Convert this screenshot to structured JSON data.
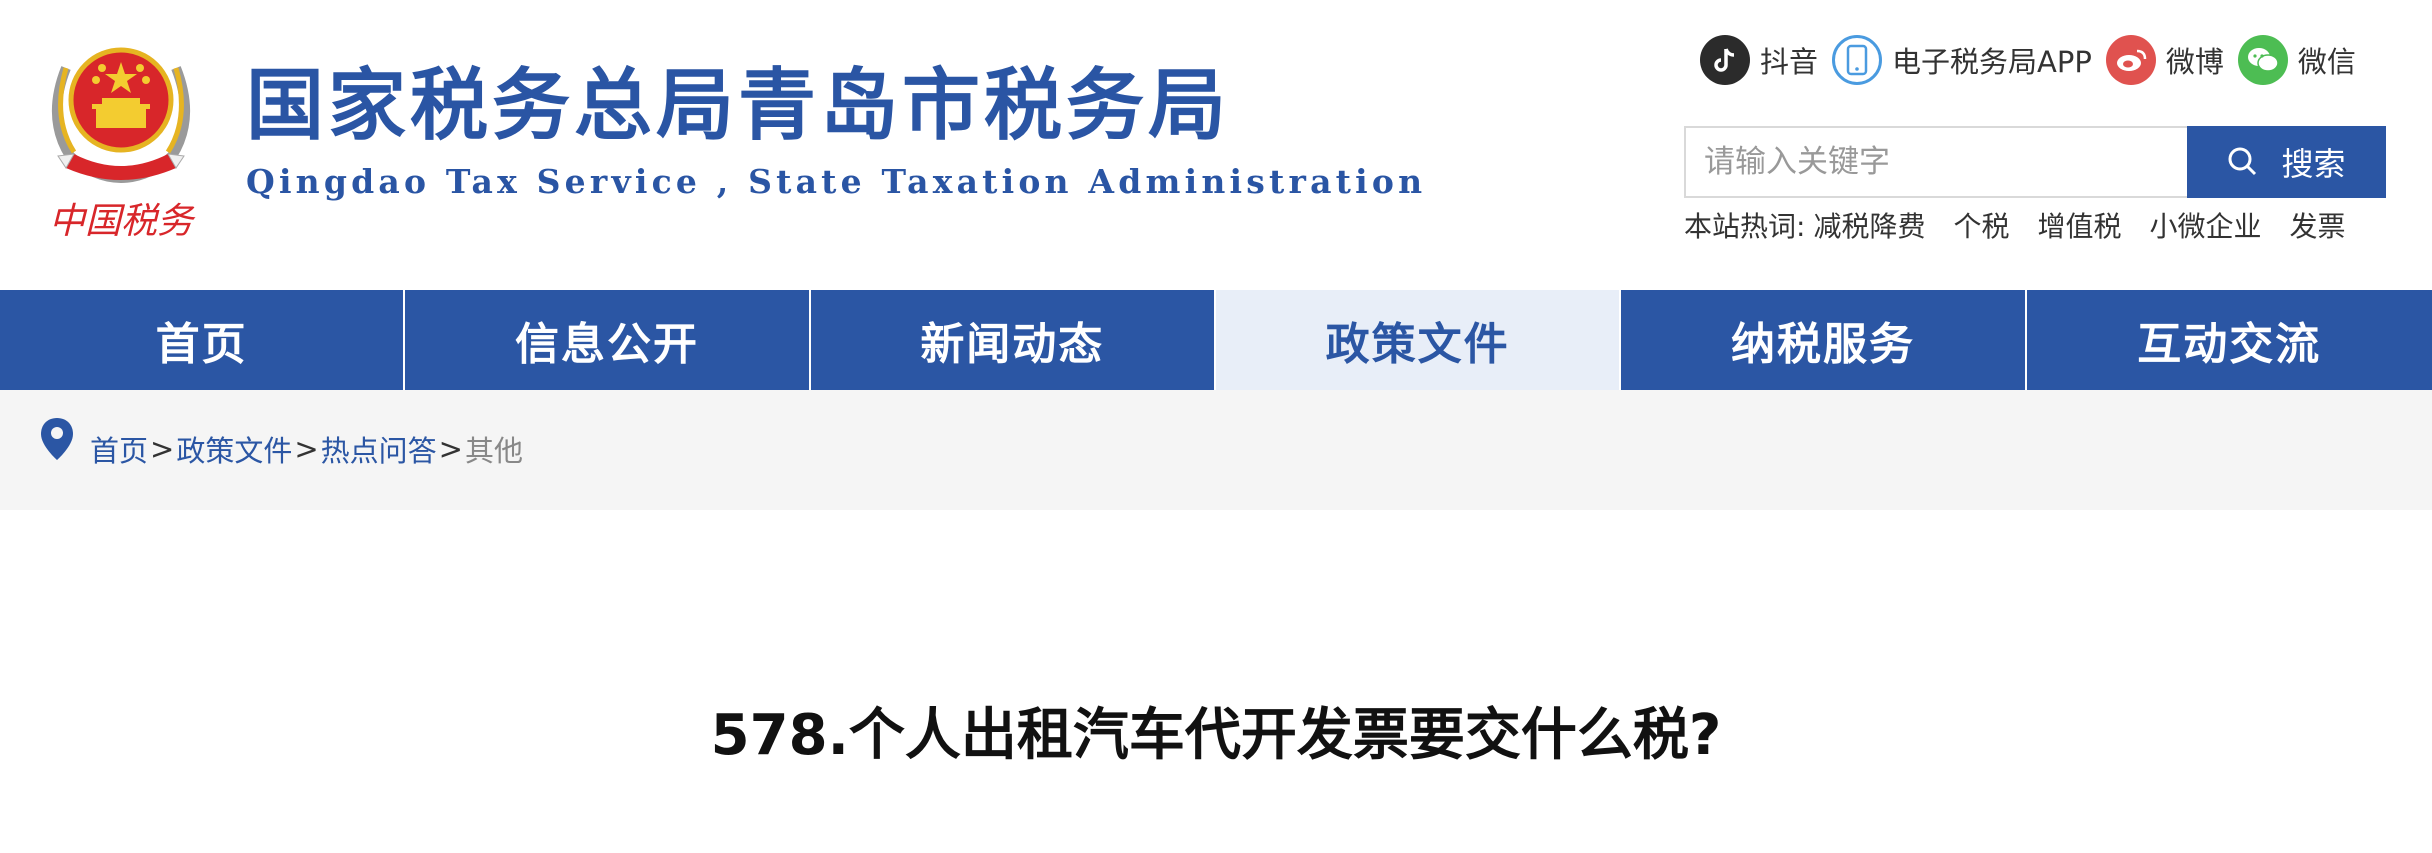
{
  "header": {
    "title_cn": "国家税务总局青岛市税务局",
    "title_en": "Qingdao Tax Service , State Taxation Administration",
    "emblem_caption": "中国税务"
  },
  "social": [
    {
      "label": "抖音",
      "icon": "douyin-icon"
    },
    {
      "label": "电子税务局APP",
      "icon": "mobile-app-icon"
    },
    {
      "label": "微博",
      "icon": "weibo-icon"
    },
    {
      "label": "微信",
      "icon": "wechat-icon"
    }
  ],
  "search": {
    "placeholder": "请输入关键字",
    "button_label": "搜索"
  },
  "hotwords": {
    "label": "本站热词:",
    "items": [
      "减税降费",
      "个税",
      "增值税",
      "小微企业",
      "发票"
    ]
  },
  "nav": {
    "items": [
      "首页",
      "信息公开",
      "新闻动态",
      "政策文件",
      "纳税服务",
      "互动交流"
    ],
    "active": "政策文件"
  },
  "breadcrumb": {
    "items": [
      "首页",
      "政策文件",
      "热点问答"
    ],
    "current": "其他",
    "separator": ">"
  },
  "article": {
    "title": "578.个人出租汽车代开发票要交什么税?"
  },
  "colors": {
    "brand_blue": "#2b56a4",
    "nav_active_bg": "#e8eef8",
    "crumb_bg": "#f5f5f5",
    "emblem_red": "#d8262a",
    "emblem_gold": "#e6b422"
  }
}
